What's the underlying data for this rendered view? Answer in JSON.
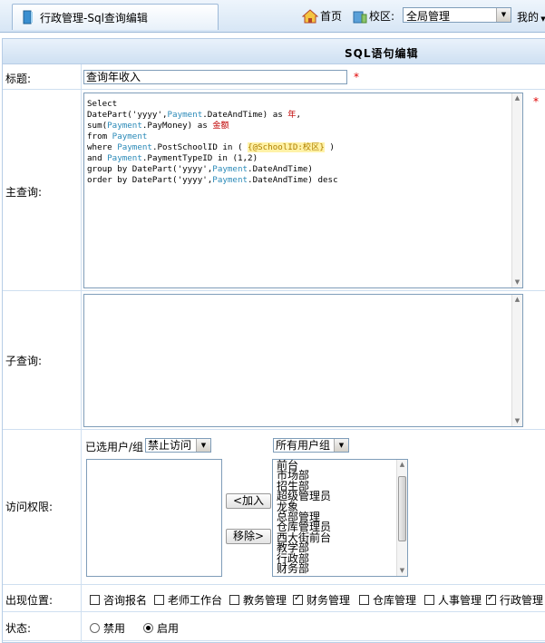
{
  "topbar": {
    "tab_title": "行政管理-Sql查询编辑",
    "home_label": "首页",
    "campus_label": "校区:",
    "campus_selected": "全局管理",
    "mine_label": "我的"
  },
  "form": {
    "header_title": "SQL语句编辑",
    "title_label": "标题:",
    "title_value": "查询年收入",
    "required_mark": "*",
    "main_query_label": "主查询:",
    "sub_query_label": "子查询:",
    "access_label": "访问权限:",
    "selected_groups_label": "已选用户/组",
    "access_mode_selected": "禁止访问",
    "all_groups_selected": "所有用户组",
    "add_button": "<加入",
    "remove_button": "移除>",
    "user_groups": [
      "前台",
      "市场部",
      "招生部",
      "超级管理员",
      "龙象",
      "总部管理",
      "仓库管理员",
      "西大街前台",
      "教学部",
      "行政部",
      "财务部"
    ],
    "position_label": "出现位置:",
    "positions": [
      {
        "label": "咨询报名",
        "checked": false
      },
      {
        "label": "老师工作台",
        "checked": false
      },
      {
        "label": "教务管理",
        "checked": false
      },
      {
        "label": "财务管理",
        "checked": true
      },
      {
        "label": "仓库管理",
        "checked": false
      },
      {
        "label": "人事管理",
        "checked": false
      },
      {
        "label": "行政管理",
        "checked": true
      }
    ],
    "status_label": "状态:",
    "status_disabled": "禁用",
    "status_enabled": "启用"
  }
}
